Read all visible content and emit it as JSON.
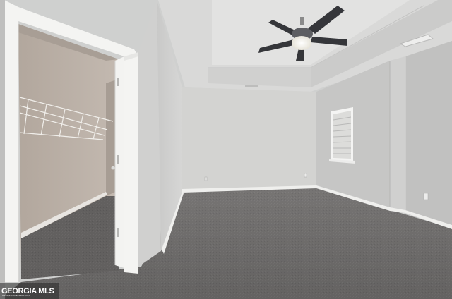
{
  "photo": {
    "subject": "empty-bedroom-with-walk-in-closet",
    "colors": {
      "wall_light": "#d3d3d1",
      "wall_shade": "#bdbdbc",
      "ceiling": "#dcdcdb",
      "carpet": "#6f6d6c",
      "closet_wall": "#b8aea5",
      "trim": "#f2f2f0",
      "fan_dark": "#2f3032",
      "light_glow": "#f4f2ea"
    },
    "watermark": {
      "text": "GEORGIA MLS",
      "subtext": "REAL ESTATE SERVICES",
      "icon": "house-roof-icon"
    }
  }
}
